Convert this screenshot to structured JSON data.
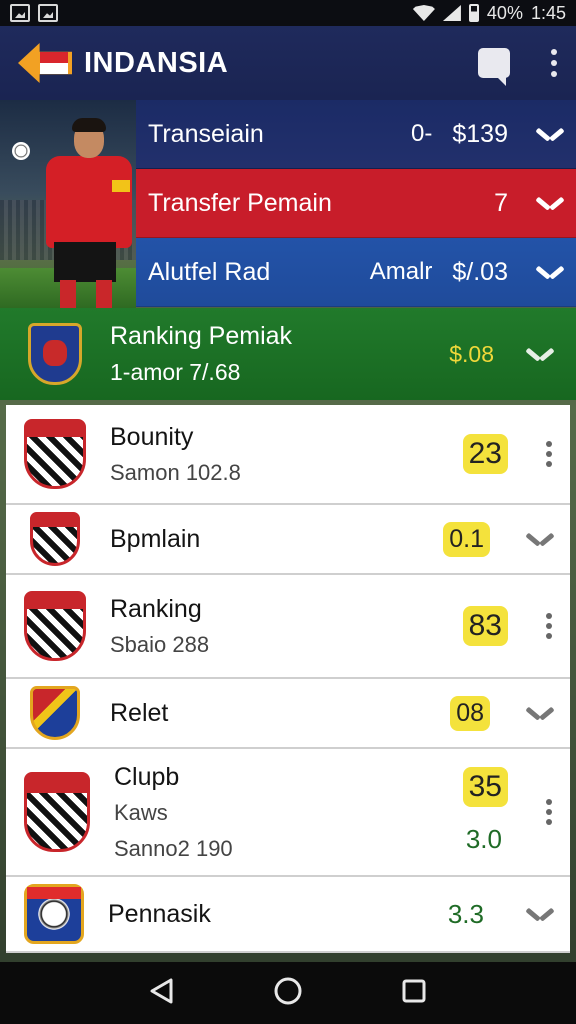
{
  "status_bar": {
    "battery": "40%",
    "time": "1:45"
  },
  "app_bar": {
    "title": "INDANSIA"
  },
  "hero_rows": [
    {
      "label": "Transeiain",
      "mid": "0-",
      "value": "$139"
    },
    {
      "label": "Transfer Pemain",
      "mid": "",
      "value": "7"
    },
    {
      "label": "Alutfel Rad",
      "mid": "Amalr",
      "value": "$/.03"
    }
  ],
  "ranking_bar": {
    "title": "Ranking Pemiak",
    "subtitle": "1-amor 7/.68",
    "value": "$.08"
  },
  "list": [
    {
      "name": "Bounity",
      "sub": "Samon 102.8",
      "score": "23",
      "action": "more"
    },
    {
      "name": "Bpmlain",
      "sub": "",
      "score": "0.1",
      "action": "expand"
    },
    {
      "name": "Ranking",
      "sub": "Sbaio 288",
      "score": "83",
      "action": "more"
    },
    {
      "name": "Relet",
      "sub": "",
      "score": "08",
      "action": "expand"
    },
    {
      "name": "Clupb",
      "sub": "Kaws",
      "sub2": "Sanno2 190",
      "score": "35",
      "score2": "3.0",
      "action": "more"
    },
    {
      "name": "Pennasik",
      "sub": "",
      "score": "3.3",
      "action": "expand"
    }
  ],
  "colors": {
    "app_bar": "#1f2a5c",
    "hero_navy": "#1b2b66",
    "hero_red": "#c81d2a",
    "hero_blue": "#2353a8",
    "ranking_green": "#217a2b",
    "score_highlight": "#f4e23c"
  },
  "icons": [
    "back-arrow-flag-icon",
    "chat-icon",
    "more-vert-icon",
    "chevron-down-icon",
    "club-crest-icon",
    "nav-back-icon",
    "nav-home-icon",
    "nav-recents-icon"
  ]
}
